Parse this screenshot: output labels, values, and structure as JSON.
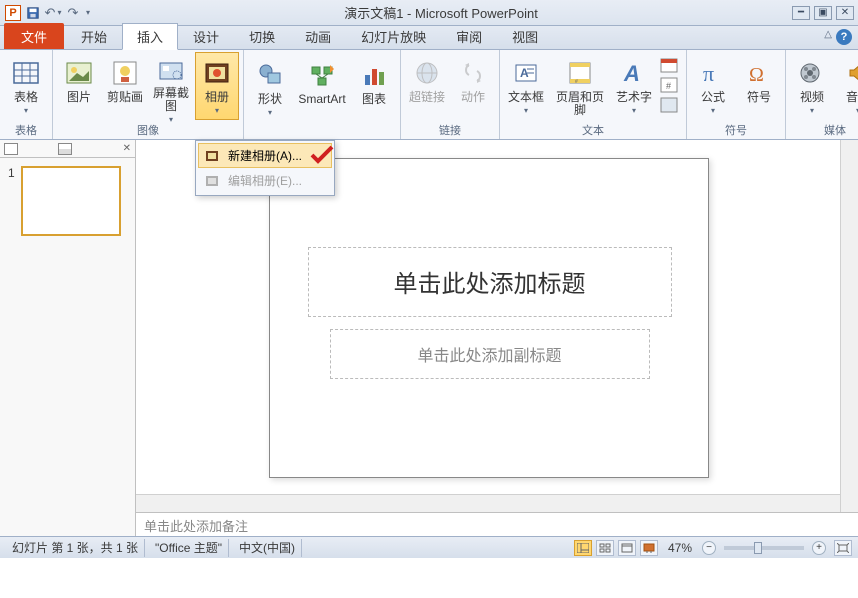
{
  "title": "演示文稿1 - Microsoft PowerPoint",
  "tabs": {
    "file": "文件",
    "home": "开始",
    "insert": "插入",
    "design": "设计",
    "transitions": "切换",
    "animations": "动画",
    "slideshow": "幻灯片放映",
    "review": "审阅",
    "view": "视图"
  },
  "ribbon": {
    "tables": {
      "label": "表格",
      "btn": "表格"
    },
    "images": {
      "label": "图像",
      "picture": "图片",
      "screenshot": "剪贴画",
      "screencap": "屏幕截图",
      "album": "相册"
    },
    "illustrations": {
      "shapes": "形状",
      "smartart": "SmartArt",
      "chart": "图表"
    },
    "links": {
      "label": "链接",
      "hyperlink": "超链接",
      "action": "动作"
    },
    "text": {
      "label": "文本",
      "textbox": "文本框",
      "headerfooter": "页眉和页脚",
      "wordart": "艺术字"
    },
    "symbols": {
      "label": "符号",
      "equation": "公式",
      "symbol": "符号"
    },
    "media": {
      "label": "媒体",
      "video": "视频",
      "audio": "音频"
    }
  },
  "dropdown": {
    "newalbum": "新建相册(A)...",
    "editalbum": "编辑相册(E)..."
  },
  "thumbs": {
    "num1": "1"
  },
  "slide": {
    "title_ph": "单击此处添加标题",
    "subtitle_ph": "单击此处添加副标题"
  },
  "notes": "单击此处添加备注",
  "status": {
    "slideinfo": "幻灯片 第 1 张，共 1 张",
    "theme": "\"Office 主题\"",
    "lang": "中文(中国)",
    "zoom": "47%"
  }
}
